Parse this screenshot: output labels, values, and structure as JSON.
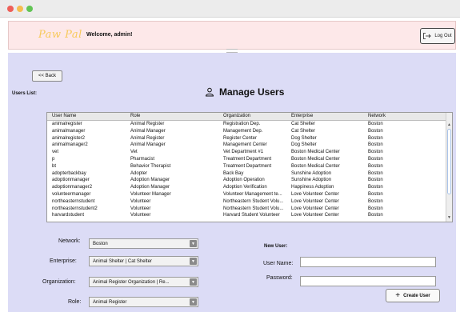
{
  "header": {
    "logo": "Paw Pal",
    "welcome": "Welcome, admin!",
    "logout_label": "Log Out"
  },
  "nav": {
    "back_label": "<< Back",
    "users_list_label": "Users List:"
  },
  "page": {
    "title": "Manage Users"
  },
  "table": {
    "columns": [
      "User Name",
      "Role",
      "Organization",
      "Enterprise",
      "Network"
    ],
    "rows": [
      [
        "animalregister",
        "Animal Register",
        "Registration Dep.",
        "Cat Shelter",
        "Boston"
      ],
      [
        "animalmanager",
        "Animal Manager",
        "Management Dep.",
        "Cat Shelter",
        "Boston"
      ],
      [
        "animalregister2",
        "Animal Register",
        "Register Center",
        "Dog Shelter",
        "Boston"
      ],
      [
        "animalmanager2",
        "Animal Manager",
        "Management Center",
        "Dog Shelter",
        "Boston"
      ],
      [
        "vet",
        "Vet",
        "Vet Department #1",
        "Boston Medical Center",
        "Boston"
      ],
      [
        "p",
        "Pharmacist",
        "Treatment Department",
        "Boston Medical Center",
        "Boston"
      ],
      [
        "bt",
        "Behavior Therapist",
        "Treatment Department",
        "Boston Medical Center",
        "Boston"
      ],
      [
        "adopterbackbay",
        "Adopter",
        "Back Bay",
        "Sunshine Adoption",
        "Boston"
      ],
      [
        "adoptionmanager",
        "Adoption Manager",
        "Adoption Operation",
        "Sunshine Adoption",
        "Boston"
      ],
      [
        "adoptionmanager2",
        "Adoption Manager",
        "Adoption Verification",
        "Happiness Adoption",
        "Boston"
      ],
      [
        "volunteermanager",
        "Volunteer Manager",
        "Volunteer Management te...",
        "Love Volunteer Center",
        "Boston"
      ],
      [
        "northeasternstudent",
        "Volunteer",
        "Northeastern Student Volu...",
        "Love Volunteer Center",
        "Boston"
      ],
      [
        "northeasternstudent2",
        "Volunteer",
        "Northeastern Student Volu...",
        "Love Volunteer Center",
        "Boston"
      ],
      [
        "harvardstudent",
        "Volunteer",
        "Harvard Student Volunteer",
        "Love Volunteer Center",
        "Boston"
      ]
    ]
  },
  "form": {
    "network_label": "Network:",
    "network_value": "Boston",
    "enterprise_label": "Enterprise:",
    "enterprise_value": "Animal Shelter | Cat Shelter",
    "organization_label": "Organization:",
    "organization_value": "Animal Register Organization | Re...",
    "role_label": "Role:",
    "role_value": "Animal Register",
    "new_user_label": "New User:",
    "username_label": "User Name:",
    "username_value": "",
    "password_label": "Password:",
    "password_value": "",
    "create_label": "Create User"
  },
  "icons": {
    "logout": "logout-arrow-icon",
    "title": "user-icon",
    "create": "plus-icon",
    "dropdown": "chevron-down-icon"
  },
  "colors": {
    "header_bg": "#fde8e9",
    "panel_bg": "#dcdcf6",
    "logo": "#f7c95a",
    "traffic_red": "#ee5f58",
    "traffic_yellow": "#f5bd4f",
    "traffic_green": "#61c454"
  }
}
